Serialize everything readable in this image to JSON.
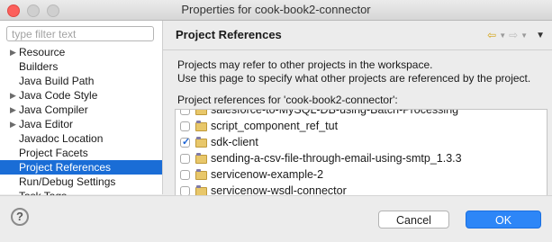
{
  "window": {
    "title": "Properties for cook-book2-connector"
  },
  "sidebar": {
    "filter_placeholder": "type filter text",
    "items": [
      {
        "label": "Resource",
        "expandable": true
      },
      {
        "label": "Builders",
        "expandable": false
      },
      {
        "label": "Java Build Path",
        "expandable": false
      },
      {
        "label": "Java Code Style",
        "expandable": true
      },
      {
        "label": "Java Compiler",
        "expandable": true
      },
      {
        "label": "Java Editor",
        "expandable": true
      },
      {
        "label": "Javadoc Location",
        "expandable": false
      },
      {
        "label": "Project Facets",
        "expandable": false
      },
      {
        "label": "Project References",
        "expandable": false,
        "selected": true
      },
      {
        "label": "Run/Debug Settings",
        "expandable": false
      },
      {
        "label": "Task Tags",
        "expandable": false
      }
    ]
  },
  "page": {
    "title": "Project References",
    "description_1": "Projects may refer to other projects in the workspace.",
    "description_2": "Use this page to specify what other projects are referenced by the project.",
    "references_label": "Project references for 'cook-book2-connector':",
    "projects": [
      {
        "label": "salesforce-to-MySQL-DB-using-Batch-Processing",
        "checked": false
      },
      {
        "label": "script_component_ref_tut",
        "checked": false
      },
      {
        "label": "sdk-client",
        "checked": true
      },
      {
        "label": "sending-a-csv-file-through-email-using-smtp_1.3.3",
        "checked": false
      },
      {
        "label": "servicenow-example-2",
        "checked": false
      },
      {
        "label": "servicenow-wsdl-connector",
        "checked": false
      }
    ]
  },
  "footer": {
    "cancel_label": "Cancel",
    "ok_label": "OK",
    "help_symbol": "?"
  },
  "colors": {
    "selection": "#1a6dd6",
    "ok_button": "#2d86f7",
    "close_light": "#fc605c"
  }
}
